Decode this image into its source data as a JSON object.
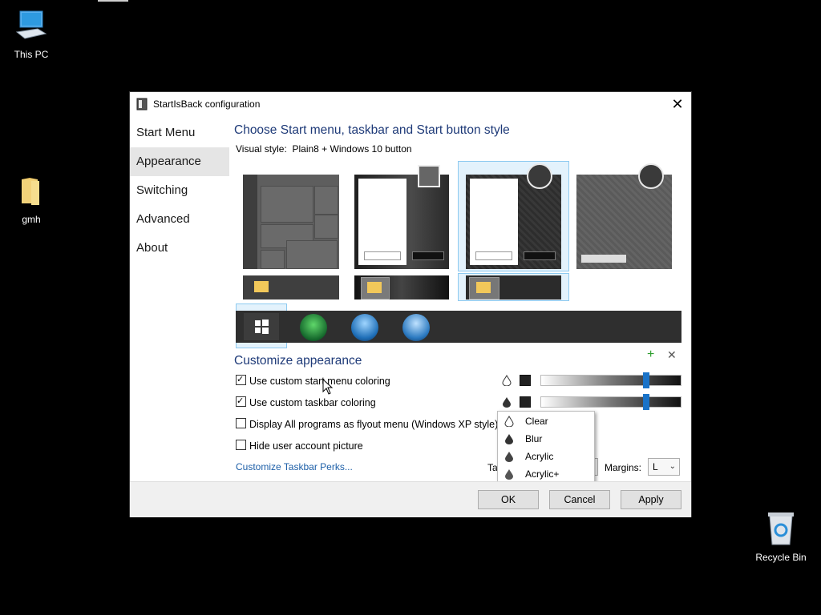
{
  "desktop": {
    "icons": [
      {
        "label": "This PC"
      },
      {
        "label": "gmh"
      },
      {
        "label": "Recycle Bin"
      }
    ]
  },
  "dialog": {
    "title": "StartIsBack configuration",
    "close_glyph": "✕",
    "sidebar": [
      "Start Menu",
      "Appearance",
      "Switching",
      "Advanced",
      "About"
    ],
    "selected_sidebar": "Appearance",
    "style_heading": "Choose Start menu, taskbar and Start button style",
    "visual_style_label": "Visual style:",
    "visual_style_value": "Plain8 + Windows 10 button",
    "customize_heading": "Customize appearance",
    "add_glyph": "+",
    "remove_glyph": "✕",
    "checkboxes": [
      {
        "label": "Use custom start menu coloring",
        "checked": true
      },
      {
        "label": "Use custom taskbar coloring",
        "checked": true
      },
      {
        "label": "Display All programs as flyout menu (Windows XP style)",
        "checked": false
      },
      {
        "label": "Hide user account picture",
        "checked": false
      }
    ],
    "perks_link": "Customize Taskbar Perks...",
    "sliders": [
      {
        "name": "start-menu-transparency",
        "value": 0.75
      },
      {
        "name": "taskbar-transparency",
        "value": 0.75
      }
    ],
    "popup_items": [
      "Clear",
      "Blur",
      "Acrylic",
      "Acrylic+"
    ],
    "partial_label": "Ta",
    "margins_label": "Margins:",
    "margins_value": "L",
    "chevron_glyph": "⌄",
    "buttons": {
      "ok": "OK",
      "cancel": "Cancel",
      "apply": "Apply"
    },
    "accent_color": "#1a73c8",
    "heading_color": "#1e3a78"
  }
}
